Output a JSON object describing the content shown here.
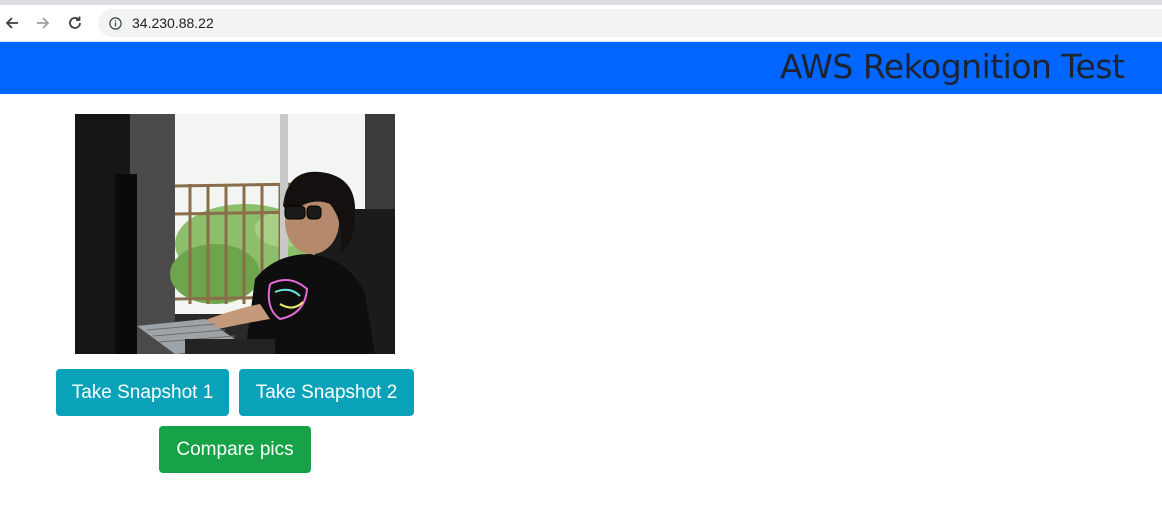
{
  "browser": {
    "url": "34.230.88.22"
  },
  "header": {
    "title": "AWS Rekognition Test",
    "background": "#0066ff"
  },
  "webcam": {
    "icon": "webcam-image"
  },
  "buttons": {
    "snapshot1_label": "Take Snapshot 1",
    "snapshot2_label": "Take Snapshot 2",
    "compare_label": "Compare pics",
    "snapshot_color": "#0aa2b8",
    "compare_color": "#16a347"
  }
}
